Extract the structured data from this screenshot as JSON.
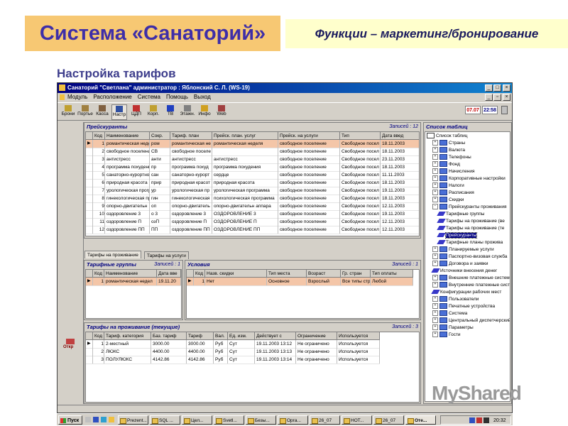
{
  "slide": {
    "title": "Система «Санаторий»",
    "subtitle": "Функции – маркетинг/бронирование",
    "heading": "Настройка тарифов"
  },
  "window": {
    "title": "Санаторий \"Светлана\" администратор : Яблонский С. Л. (WS-19)",
    "menu": [
      "Модуль",
      "Расположение",
      "Система",
      "Помощь",
      "Выход"
    ],
    "toolbar": [
      "Брони",
      "Портье",
      "Касса",
      "Настр",
      "ЦДП",
      "Корп.",
      "ТВ",
      "Этажн.",
      "Инфо",
      "Web"
    ],
    "date": "07.07",
    "time": "22:58"
  },
  "pricelists": {
    "title": "Прейскуранты",
    "count": "Записей : 12",
    "columns": [
      "Код",
      "Наименование",
      "Сокр.",
      "Тариф. план",
      "Прейск. план. услуг",
      "Прейск. на услуги",
      "Тип",
      "Дата введ"
    ],
    "rows": [
      [
        "1",
        "романтическая недел",
        "ром",
        "романтическая не",
        "романтическая неделя",
        "свободное поселение",
        "Свободное посел",
        "18.11.2003"
      ],
      [
        "2",
        "свободное поселение",
        "СВ",
        "свободное поселе",
        "",
        "свободное поселение",
        "Свободное посел",
        "18.11.2003"
      ],
      [
        "3",
        "антистресс",
        "анти",
        "антистресс",
        "антистресс",
        "свободное поселение",
        "Свободное посел",
        "23.11.2003"
      ],
      [
        "4",
        "программа похудения",
        "пр",
        "программа похуд",
        "программа похудения",
        "свободное поселение",
        "Свободное посел",
        "18.11.2003"
      ],
      [
        "5",
        "санаторно-курортное",
        "сан",
        "санаторно-курорт",
        "сердце",
        "свободное поселение",
        "Свободное посел",
        "11.11.2003"
      ],
      [
        "6",
        "природная красота",
        "прир",
        "природная красот",
        "природная красота",
        "свободное поселение",
        "Свободное посел",
        "18.11.2003"
      ],
      [
        "7",
        "урологическая прогр",
        "ур",
        "урологическая пр",
        "урологическая программа",
        "свободное поселение",
        "Свободное посел",
        "19.11.2003"
      ],
      [
        "8",
        "гинекологическая пр",
        "гин",
        "гинекологическая",
        "психологическая программа",
        "свободное поселение",
        "Свободное посел",
        "18.11.2003"
      ],
      [
        "9",
        "опорно-двигательн",
        "оп",
        "опорно-двигатель",
        "опорно-двигательн аппара",
        "свободное поселение",
        "Свободное посел",
        "12.11.2003"
      ],
      [
        "10",
        "оздоровление 3",
        "о 3",
        "оздоровление 3",
        "ОЗДОРОВЛЕНИЕ 3",
        "свободное поселение",
        "Свободное посел",
        "19.11.2003"
      ],
      [
        "11",
        "оздоровление П",
        "озП",
        "оздоровление П",
        "ОЗДОРОВЛЕНИЕ П",
        "свободное поселение",
        "Свободное посел",
        "12.11.2003"
      ],
      [
        "12",
        "оздоровление ПП",
        "ПП",
        "оздоровление ПП",
        "ОЗДОРОВЛЕНИЕ ПП",
        "свободное поселение",
        "Свободное посел",
        "12.11.2003"
      ]
    ]
  },
  "tabs": [
    "Тарифы на проживание",
    "Тарифы на услуги"
  ],
  "tariff_groups": {
    "title": "Тарифные группы",
    "count": "Записей : 1",
    "columns": [
      "Код",
      "Наименование",
      "Дата вве"
    ],
    "rows": [
      [
        "1",
        "романтическая недел",
        "19.11.20"
      ]
    ]
  },
  "conditions": {
    "title": "Условия",
    "count": "Записей : 1",
    "columns": [
      "Код",
      "Назв. скидки",
      "Тип места",
      "Возраст",
      "Гр. стран",
      "Тип оплаты"
    ],
    "rows": [
      [
        "1",
        "Нет",
        "Основное",
        "Взрослый",
        "Все типы стр",
        "Любой"
      ]
    ]
  },
  "current_tariffs": {
    "title": "Тарифы на проживание (текущие)",
    "count": "Записей : 3",
    "columns": [
      "Код",
      "Тариф. категория",
      "Баз. тариф",
      "Тариф",
      "Вал.",
      "Ед. изм.",
      "Действует с",
      "Ограничение",
      "Используется"
    ],
    "rows": [
      [
        "1",
        "2-местный",
        "3000.00",
        "3000.00",
        "Руб",
        "Сут",
        "19.11.2003 13:12",
        "Не ограничено",
        "Используется"
      ],
      [
        "2",
        "ЛЮКС",
        "4400.00",
        "4400.00",
        "Руб",
        "Сут",
        "19.11.2003 13:13",
        "Не ограничено",
        "Используется"
      ],
      [
        "3",
        "ПОЛУЛЮКС",
        "4142.86",
        "4142.86",
        "Руб",
        "Сут",
        "19.11.2003 13:14",
        "Не ограничено",
        "Используется"
      ]
    ],
    "side_label": "Откр"
  },
  "table_list": {
    "title": "Список таблиц",
    "items": [
      {
        "label": "Список таблиц",
        "level": 0,
        "kind": "root"
      },
      {
        "label": "Страны",
        "level": 1,
        "kind": "tbl"
      },
      {
        "label": "Валюта",
        "level": 1,
        "kind": "tbl"
      },
      {
        "label": "Телефоны",
        "level": 1,
        "kind": "tbl"
      },
      {
        "label": "Фонд",
        "level": 1,
        "kind": "tbl"
      },
      {
        "label": "Начисления",
        "level": 1,
        "kind": "tbl"
      },
      {
        "label": "Корпоративные настройки",
        "level": 1,
        "kind": "tbl"
      },
      {
        "label": "Налоги",
        "level": 1,
        "kind": "tbl"
      },
      {
        "label": "Расписания",
        "level": 1,
        "kind": "tbl"
      },
      {
        "label": "Скидки",
        "level": 1,
        "kind": "tbl"
      },
      {
        "label": "Прейскуранты проживания",
        "level": 1,
        "kind": "tbl"
      },
      {
        "label": "Тарифные группы",
        "level": 2,
        "kind": "pen"
      },
      {
        "label": "Тарифы на проживание (ве",
        "level": 2,
        "kind": "pen"
      },
      {
        "label": "Тарифы на проживание (те",
        "level": 2,
        "kind": "pen"
      },
      {
        "label": "Прейскуранты",
        "level": 2,
        "kind": "sel"
      },
      {
        "label": "Тарифные планы прожива",
        "level": 2,
        "kind": "pen"
      },
      {
        "label": "Планируемые услуги",
        "level": 1,
        "kind": "tbl"
      },
      {
        "label": "Паспортно-визовая служба",
        "level": 1,
        "kind": "tbl"
      },
      {
        "label": "Договора и заявки",
        "level": 1,
        "kind": "tbl"
      },
      {
        "label": "Источники внесения денег",
        "level": 1,
        "kind": "pen"
      },
      {
        "label": "Внешние платежные системы",
        "level": 1,
        "kind": "tbl"
      },
      {
        "label": "Внутренние платежные систем",
        "level": 1,
        "kind": "tbl"
      },
      {
        "label": "Конфигурации рабочих мест",
        "level": 1,
        "kind": "pen"
      },
      {
        "label": "Пользователи",
        "level": 1,
        "kind": "tbl"
      },
      {
        "label": "Печатные устройства",
        "level": 1,
        "kind": "tbl"
      },
      {
        "label": "Система",
        "level": 1,
        "kind": "tbl"
      },
      {
        "label": "Центральный диспетчерский п",
        "level": 1,
        "kind": "tbl"
      },
      {
        "label": "Параметры",
        "level": 1,
        "kind": "tbl"
      },
      {
        "label": "Гости",
        "level": 1,
        "kind": "tbl"
      }
    ]
  },
  "taskbar": {
    "start": "Пуск",
    "tasks": [
      "Prezent...",
      "SQL ...",
      "Цел...",
      "Svetl...",
      "Безы...",
      "Орга...",
      "26_07",
      "НОТ...",
      "26_07",
      "Оте..."
    ],
    "clock": "20:32"
  },
  "watermark": "MyShared"
}
